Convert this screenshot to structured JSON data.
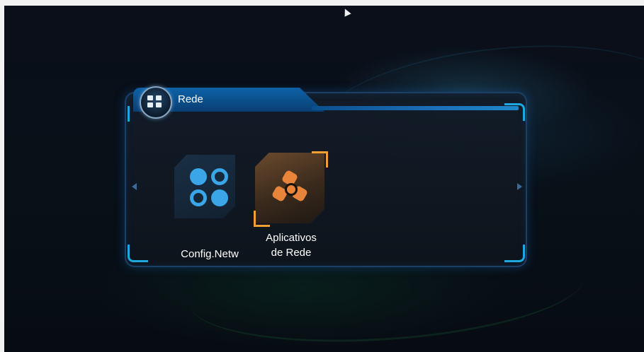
{
  "menu": {
    "title": "Rede",
    "items": [
      {
        "label": "Config.Netw",
        "icon": "network-config-icon",
        "selected": false
      },
      {
        "label_line1": "Aplicativos",
        "label_line2": "de Rede",
        "icon": "network-apps-icon",
        "selected": true
      }
    ]
  },
  "colors": {
    "accent": "#1ea8e0",
    "selection": "#f0a030",
    "app_icon_blue": "#3aa6e8",
    "app_icon_orange": "#e8853a"
  }
}
